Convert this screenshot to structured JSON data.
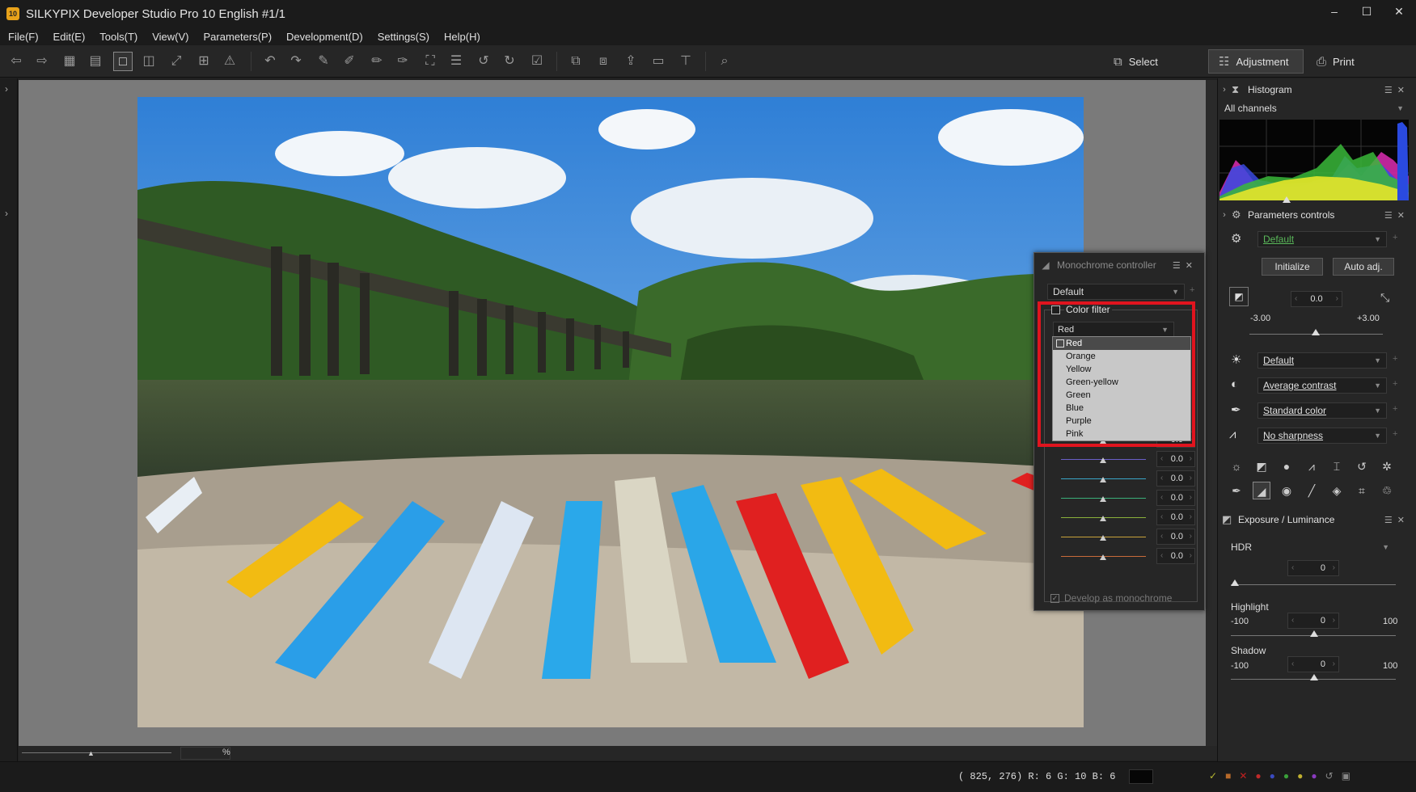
{
  "window": {
    "title": "SILKYPIX Developer Studio Pro 10 English   #1/1",
    "app_icon_text": "10",
    "controls": [
      "–",
      "☐",
      "✕"
    ]
  },
  "menu": [
    "File(F)",
    "Edit(E)",
    "Tools(T)",
    "View(V)",
    "Parameters(P)",
    "Development(D)",
    "Settings(S)",
    "Help(H)"
  ],
  "modes": {
    "select": "Select",
    "adjustment": "Adjustment",
    "print": "Print"
  },
  "zoom": {
    "value": "",
    "unit": "%"
  },
  "status": {
    "coords": "( 825, 276) R:  6 G: 10 B:  6"
  },
  "histogram": {
    "title": "Histogram",
    "channel": "All channels"
  },
  "params": {
    "title": "Parameters controls",
    "preset": "Default",
    "initialize": "Initialize",
    "auto_adj": "Auto adj.",
    "exposure_value": "0.0",
    "exposure_min": "-3.00",
    "exposure_max": "+3.00",
    "rows": {
      "white_balance": "Default",
      "tone": "Average contrast",
      "color": "Standard color",
      "sharpness": "No sharpness"
    }
  },
  "exposure_luminance": {
    "title": "Exposure / Luminance",
    "hdr_label": "HDR",
    "hdr_value": "0",
    "highlight_label": "Highlight",
    "highlight_min": "-100",
    "highlight_max": "100",
    "highlight_value": "0",
    "shadow_label": "Shadow",
    "shadow_min": "-100",
    "shadow_max": "100",
    "shadow_value": "0"
  },
  "mono": {
    "title": "Monochrome controller",
    "preset": "Default",
    "color_filter_label": "Color filter",
    "color_filter_value": "Red",
    "filter_options": [
      "Red",
      "Orange",
      "Yellow",
      "Green-yellow",
      "Green",
      "Blue",
      "Purple",
      "Pink"
    ],
    "channels": [
      {
        "value": "0.0",
        "color": "#b05ab0"
      },
      {
        "value": "0.0",
        "color": "#6a5fc8"
      },
      {
        "value": "0.0",
        "color": "#3aa6c8"
      },
      {
        "value": "0.0",
        "color": "#3ab07a"
      },
      {
        "value": "0.0",
        "color": "#8ab03a"
      },
      {
        "value": "0.0",
        "color": "#c8a23a"
      },
      {
        "value": "0.0",
        "color": "#c86a3a"
      }
    ],
    "develop_label": "Develop as monochrome"
  },
  "colors": {
    "highlight_box": "#e0141e",
    "accent_green": "#4caf50"
  }
}
